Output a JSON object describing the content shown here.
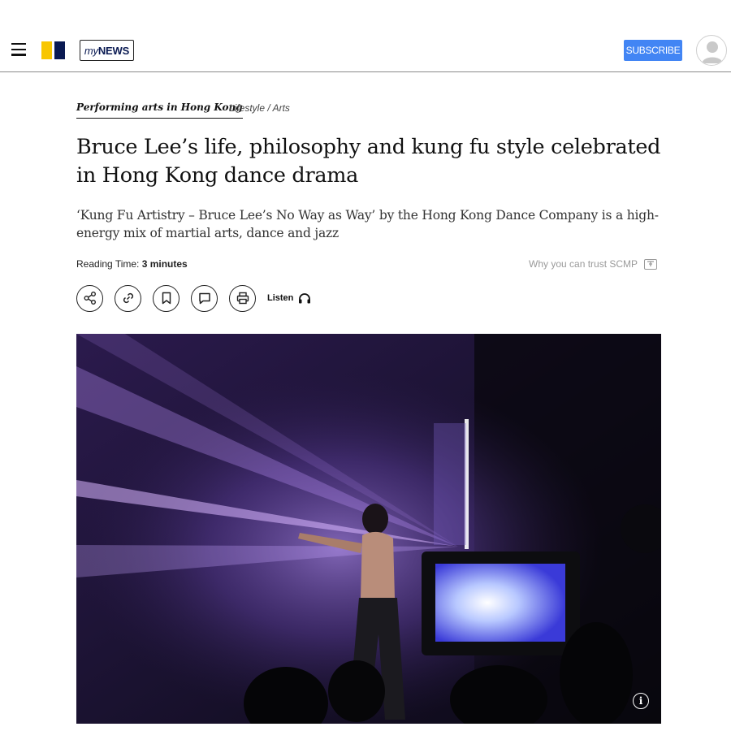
{
  "header": {
    "logo_text_prefix": "my",
    "logo_text_suffix": "NEWS",
    "subscribe_label": "SUBSCRIBE",
    "brand_colors": {
      "yellow": "#f8c600",
      "navy": "#0a1a52",
      "subscribe_blue": "#4285f4"
    }
  },
  "article": {
    "section": "Performing arts in Hong Kong",
    "category": "Lifestyle / Arts",
    "headline": "Bruce Lee’s life, philosophy and kung fu style celebrated in Hong Kong dance drama",
    "subheadline": "‘Kung Fu Artistry – Bruce Lee’s No Way as Way’ by the Hong Kong Dance Company is a high-energy mix of martial arts, dance and jazz",
    "reading_time_label": "Reading Time:",
    "reading_time_value": "3 minutes",
    "trust_link": "Why you can trust SCMP"
  },
  "toolbar": {
    "icons": [
      "share-icon",
      "link-icon",
      "bookmark-icon",
      "comment-icon",
      "print-icon",
      "headphones-icon"
    ],
    "listen_label": "Listen"
  },
  "photo": {
    "info_glyph": "i"
  }
}
